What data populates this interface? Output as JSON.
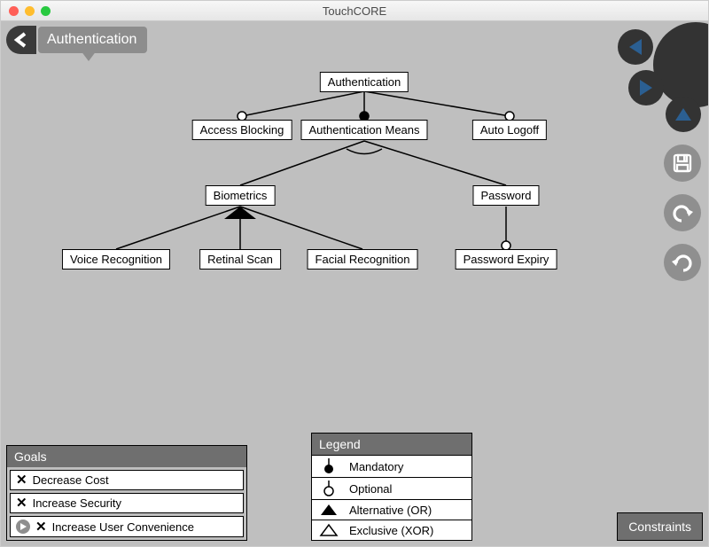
{
  "app": {
    "title": "TouchCORE"
  },
  "breadcrumb": {
    "label": "Authentication"
  },
  "nodes": {
    "root": "Authentication",
    "access_blocking": "Access Blocking",
    "auth_means": "Authentication Means",
    "auto_logoff": "Auto Logoff",
    "biometrics": "Biometrics",
    "password": "Password",
    "voice": "Voice Recognition",
    "retinal": "Retinal Scan",
    "facial": "Facial Recognition",
    "pw_expiry": "Password Expiry"
  },
  "goals": {
    "title": "Goals",
    "items": [
      "Decrease Cost",
      "Increase Security",
      "Increase User Convenience"
    ]
  },
  "legend": {
    "title": "Legend",
    "items": [
      "Mandatory",
      "Optional",
      "Alternative (OR)",
      "Exclusive (XOR)"
    ]
  },
  "constraints": {
    "label": "Constraints"
  }
}
